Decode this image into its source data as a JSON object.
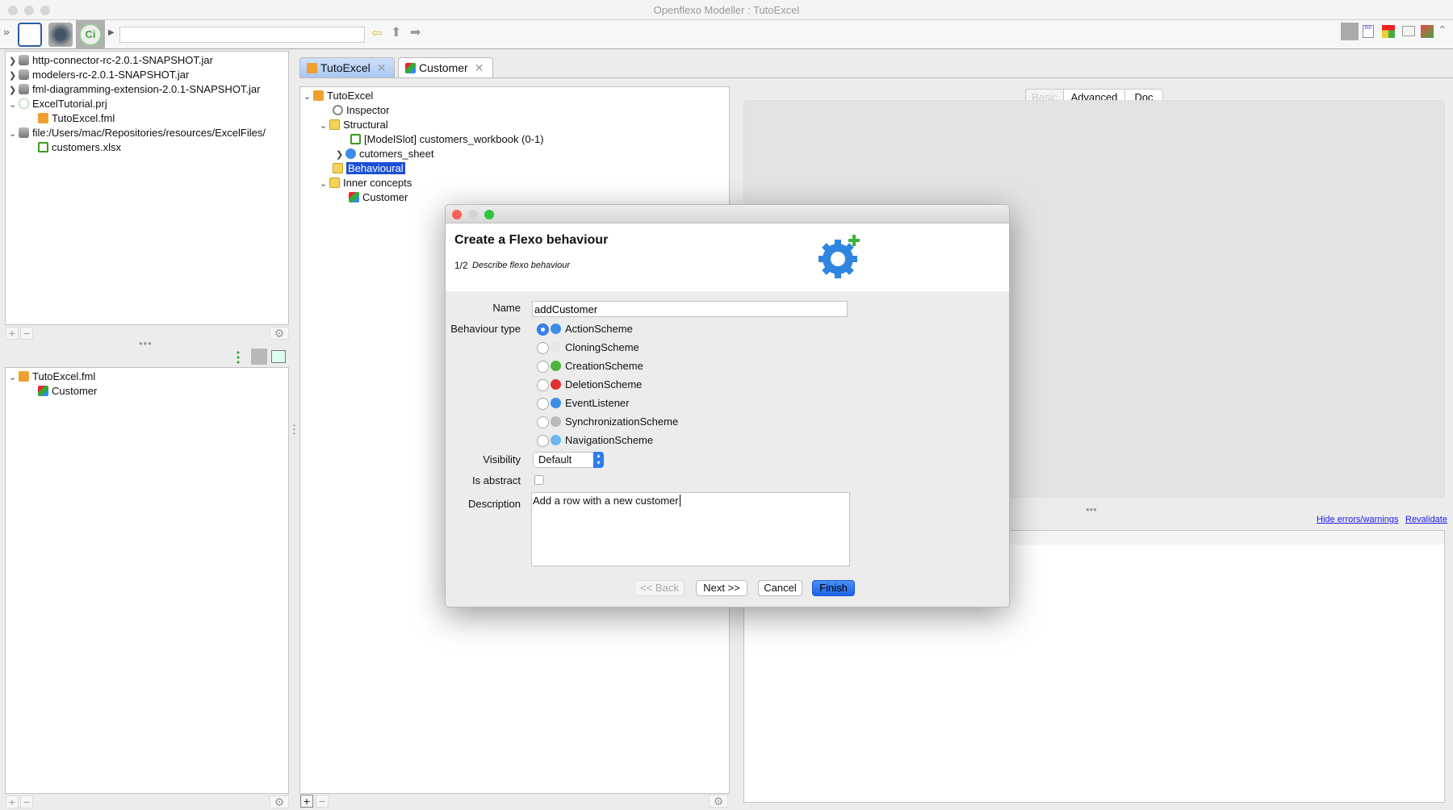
{
  "window": {
    "title": "Openflexo Modeller : TutoExcel"
  },
  "toolbar": {
    "search_value": ""
  },
  "left_top_tree": [
    {
      "label": "http-connector-rc-2.0.1-SNAPSHOT.jar",
      "icon": "jar-icon",
      "expanded": false
    },
    {
      "label": "modelers-rc-2.0.1-SNAPSHOT.jar",
      "icon": "jar-icon",
      "expanded": false
    },
    {
      "label": "fml-diagramming-extension-2.0.1-SNAPSHOT.jar",
      "icon": "jar-icon",
      "expanded": false
    },
    {
      "label": "ExcelTutorial.prj",
      "icon": "project-icon",
      "expanded": true
    },
    {
      "label": "TutoExcel.fml",
      "icon": "fml-icon",
      "child": true
    },
    {
      "label": "file:/Users/mac/Repositories/resources/ExcelFiles/",
      "icon": "jar-icon",
      "expanded": true
    },
    {
      "label": "customers.xlsx",
      "icon": "excel-icon",
      "child": true
    }
  ],
  "left_bottom_tree": [
    {
      "label": "TutoExcel.fml"
    },
    {
      "label": "Customer"
    }
  ],
  "tabs": [
    {
      "label": "TutoExcel",
      "active": true
    },
    {
      "label": "Customer",
      "active": false
    }
  ],
  "middle_tree": [
    {
      "label": "TutoExcel"
    },
    {
      "label": "Inspector"
    },
    {
      "label": "Structural"
    },
    {
      "label": "[ModelSlot] customers_workbook (0-1)"
    },
    {
      "label": "cutomers_sheet"
    },
    {
      "label": "Behavioural",
      "selected": true
    },
    {
      "label": "Inner concepts"
    },
    {
      "label": "Customer"
    }
  ],
  "inspector": {
    "tabs": [
      "Basic",
      "Advanced",
      "Doc"
    ],
    "hide_link": "Hide errors/warnings",
    "revalidate_link": "Revalidate"
  },
  "dialog": {
    "title": "Create a Flexo behaviour",
    "step": "1/2",
    "step_desc": "Describe flexo behaviour",
    "name_label": "Name",
    "name_value": "addCustomer",
    "type_label": "Behaviour type",
    "types": [
      {
        "label": "ActionScheme",
        "icon": "action-scheme-icon",
        "selected": true
      },
      {
        "label": "CloningScheme",
        "icon": "cloning-scheme-icon"
      },
      {
        "label": "CreationScheme",
        "icon": "creation-scheme-icon"
      },
      {
        "label": "DeletionScheme",
        "icon": "deletion-scheme-icon"
      },
      {
        "label": "EventListener",
        "icon": "event-listener-icon"
      },
      {
        "label": "SynchronizationScheme",
        "icon": "synchronization-scheme-icon"
      },
      {
        "label": "NavigationScheme",
        "icon": "navigation-scheme-icon"
      }
    ],
    "visibility_label": "Visibility",
    "visibility_value": "Default",
    "abstract_label": "Is abstract",
    "abstract_checked": false,
    "description_label": "Description",
    "description_value": "Add a row with a new customer",
    "back": "<< Back",
    "next": "Next >>",
    "cancel": "Cancel",
    "finish": "Finish",
    "accent": "#1f6ff0"
  }
}
